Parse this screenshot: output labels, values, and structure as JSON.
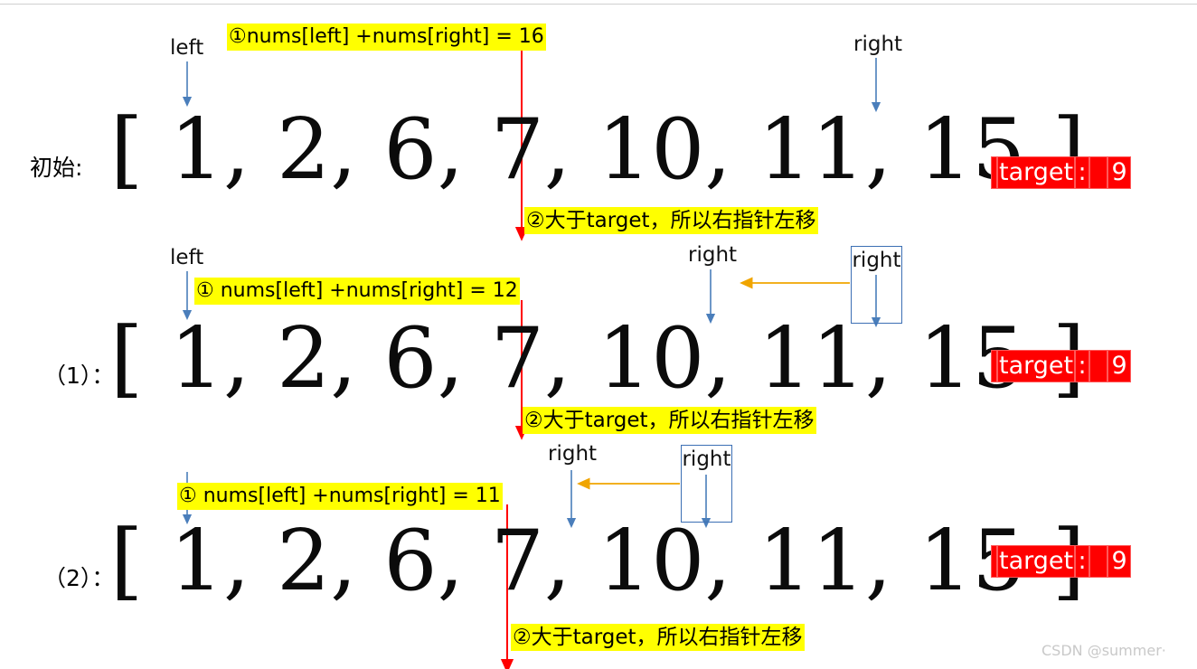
{
  "colors": {
    "highlight": "#ffff00",
    "target_bg": "#ff0000",
    "target_fg": "#ffffff",
    "pointer_arrow": "#4a7ebb",
    "move_arrow": "#f0a500",
    "step_line": "#ff0000",
    "watermark": "#c9c9c9",
    "array_text": "#0b0b0b"
  },
  "array": {
    "open_bracket": "[",
    "close_bracket": "]",
    "values": [
      1,
      2,
      6,
      7,
      10,
      11,
      15
    ],
    "text": "[ 1, 2, 6, 7, 10, 11, 15 ]"
  },
  "target_badge": {
    "label": "target",
    "colon": ":",
    "value": "9"
  },
  "pointers": {
    "left_label": "left",
    "right_label": "right"
  },
  "rows": [
    {
      "id": "row-initial",
      "label": "初始:",
      "array_text": "[ 1, 2, 6, 7, 10, 11, 15 ]",
      "target": "target: 9",
      "annotation_sum": "①nums[left] +nums[right] = 16",
      "annotation_result": "②大于target，所以右指针左移",
      "left_pointer_label": "left",
      "right_pointer_label": "right",
      "left_index": 0,
      "right_index": 6,
      "sum_value": 16
    },
    {
      "id": "row-1",
      "label": "（1）：",
      "array_text": "[ 1, 2, 6, 7, 10, 11, 15 ]",
      "target": "target: 9",
      "annotation_sum": "① nums[left] +nums[right] = 12",
      "annotation_result": "②大于target，所以右指针左移",
      "left_pointer_label": "left",
      "right_pointer_label": "right",
      "moved_from_label": "right",
      "left_index": 0,
      "right_index": 5,
      "sum_value": 12
    },
    {
      "id": "row-2",
      "label": "（2）：",
      "array_text": "[ 1, 2, 6, 7, 10, 11, 15 ]",
      "target": "target: 9",
      "annotation_sum": "① nums[left] +nums[right] = 11",
      "annotation_result": "②大于target，所以右指针左移",
      "right_pointer_label": "right",
      "moved_from_label": "right",
      "left_index": 0,
      "right_index": 4,
      "sum_value": 11
    }
  ],
  "watermark": "CSDN @summer·"
}
